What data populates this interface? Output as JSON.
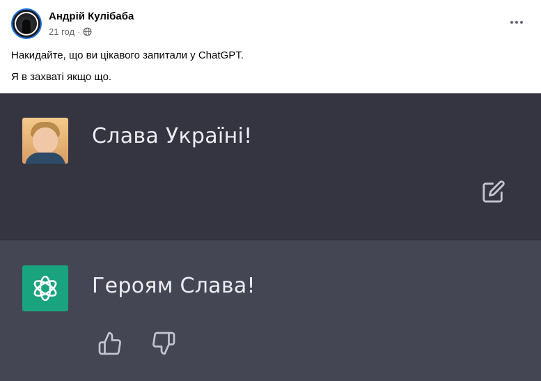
{
  "post": {
    "author": "Андрій Кулібаба",
    "time": "21 год",
    "separator": "·",
    "text_line1": "Накидайте, що ви цікавого запитали у  ChatGPT.",
    "text_line2": "Я в захваті якщо що.",
    "icons": {
      "audience": "globe-icon",
      "menu": "more-options-icon"
    }
  },
  "chat": {
    "user_message": "Слава Україні!",
    "assistant_message": "Героям Слава!",
    "colors": {
      "user_bg": "#343541",
      "assistant_bg": "#444654",
      "logo_bg": "#19a37f",
      "text": "#ececf1",
      "icon": "#c5c5d2"
    },
    "icons": {
      "edit": "edit-icon",
      "logo": "chatgpt-logo-icon",
      "thumb_up": "thumb-up-icon",
      "thumb_down": "thumb-down-icon"
    }
  }
}
